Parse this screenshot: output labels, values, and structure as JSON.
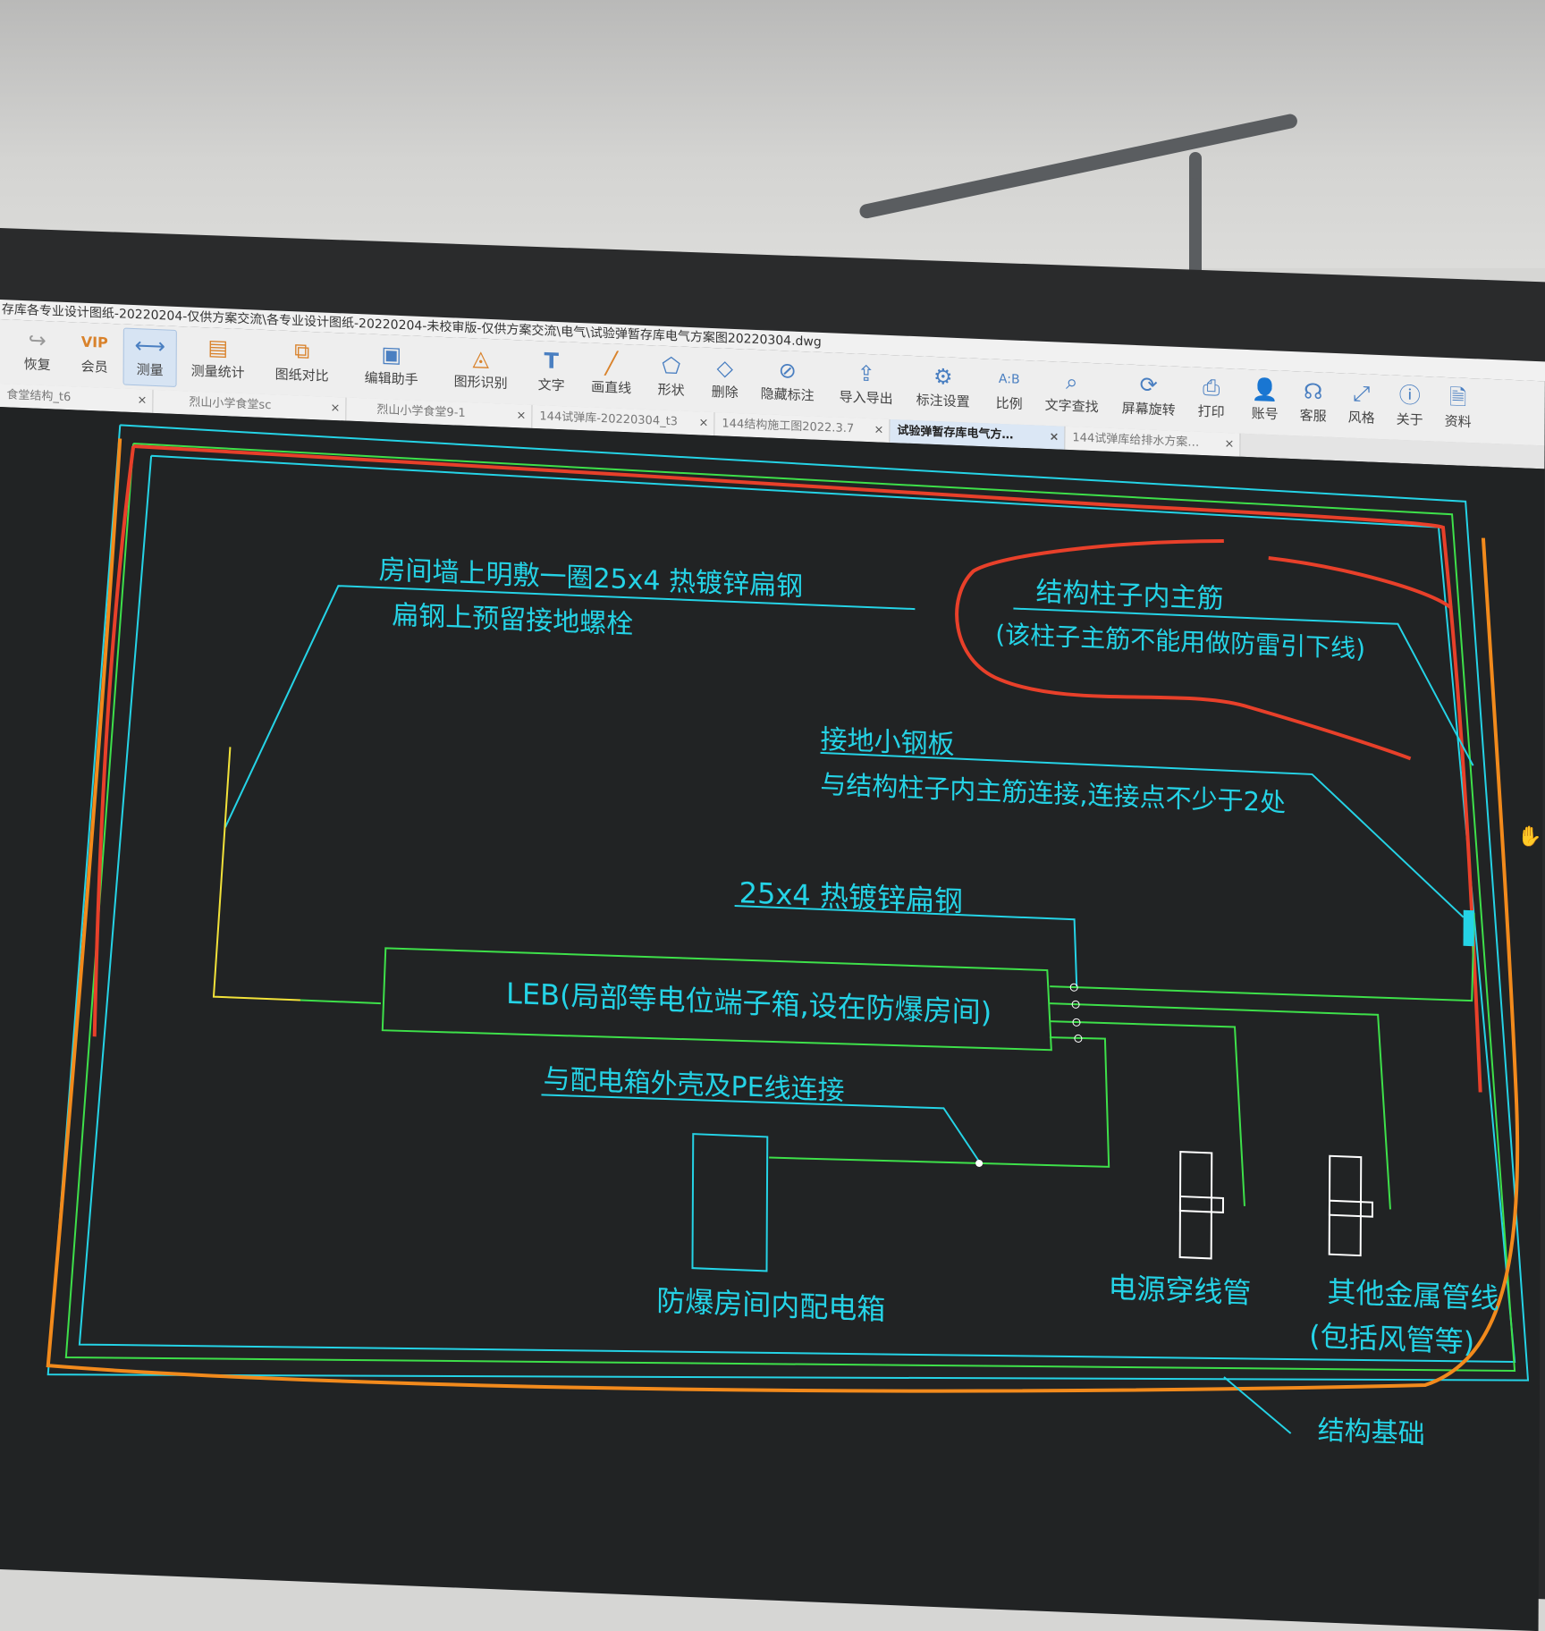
{
  "window": {
    "title": "存库各专业设计图纸-20220204-仅供方案交流\\各专业设计图纸-20220204-未校审版-仅供方案交流\\电气\\试验弹暂存库电气方案图20220304.dwg"
  },
  "toolbar": {
    "items": [
      {
        "label": "恢复",
        "icon": "redo-icon"
      },
      {
        "label": "会员",
        "icon": "vip-icon"
      },
      {
        "label": "测量",
        "icon": "measure-icon"
      },
      {
        "label": "测量统计",
        "icon": "measure-stats-icon"
      },
      {
        "label": "图纸对比",
        "icon": "compare-icon"
      },
      {
        "label": "编辑助手",
        "icon": "edit-assistant-icon"
      },
      {
        "label": "图形识别",
        "icon": "shape-recognition-icon"
      },
      {
        "label": "文字",
        "icon": "text-icon"
      },
      {
        "label": "画直线",
        "icon": "line-icon"
      },
      {
        "label": "形状",
        "icon": "shape-icon"
      },
      {
        "label": "删除",
        "icon": "eraser-icon"
      },
      {
        "label": "隐藏标注",
        "icon": "hide-annotation-icon"
      },
      {
        "label": "导入导出",
        "icon": "import-export-icon"
      },
      {
        "label": "标注设置",
        "icon": "annotation-settings-icon"
      },
      {
        "label": "比例",
        "icon": "scale-icon"
      },
      {
        "label": "文字查找",
        "icon": "text-search-icon"
      },
      {
        "label": "屏幕旋转",
        "icon": "rotate-screen-icon"
      },
      {
        "label": "打印",
        "icon": "printer-icon"
      },
      {
        "label": "账号",
        "icon": "account-icon"
      },
      {
        "label": "客服",
        "icon": "headset-icon"
      },
      {
        "label": "风格",
        "icon": "style-icon"
      },
      {
        "label": "关于",
        "icon": "info-icon"
      },
      {
        "label": "资料",
        "icon": "documents-icon"
      }
    ]
  },
  "tabs": [
    {
      "label": "食堂结构_t6"
    },
    {
      "label": "烈山小学食堂sc"
    },
    {
      "label": "烈山小学食堂9-1"
    },
    {
      "label": "144试弹库-20220304_t3"
    },
    {
      "label": "144结构施工图2022.3.7"
    },
    {
      "label": "试验弹暂存库电气方…",
      "active": true
    },
    {
      "label": "144试弹库给排水方案…"
    }
  ],
  "drawing": {
    "note_wall_1": "房间墙上明敷一圈25x4 热镀锌扁钢",
    "note_wall_2": "扁钢上预留接地螺栓",
    "note_column_1": "结构柱子内主筋",
    "note_column_2": "(该柱子主筋不能用做防雷引下线)",
    "note_plate_1": "接地小钢板",
    "note_plate_2": "与结构柱子内主筋连接,连接点不少于2处",
    "note_steel": "25x4 热镀锌扁钢",
    "leb_label": "LEB(局部等电位端子箱,设在防爆房间)",
    "note_pe": "与配电箱外壳及PE线连接",
    "label_box": "防爆房间内配电箱",
    "label_conduit": "电源穿线管",
    "label_metal_1": "其他金属管线",
    "label_metal_2": "(包括风管等)",
    "label_foundation": "结构基础"
  },
  "colors": {
    "cad_background": "#212324",
    "cyan": "#25d3e6",
    "green": "#3ee04a",
    "yellow": "#f2e23a",
    "red_markup": "#e8402a",
    "orange_markup": "#f28a1c"
  }
}
